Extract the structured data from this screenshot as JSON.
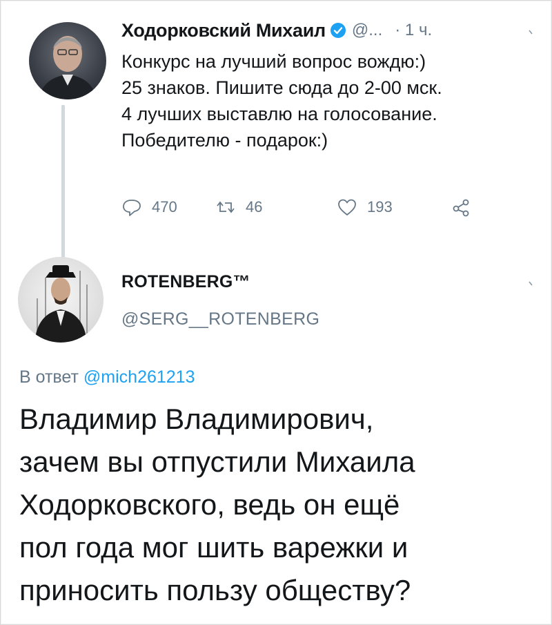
{
  "tweet1": {
    "author_name": "Ходорковский Михаил",
    "handle": "@...",
    "time": "· 1 ч.",
    "text_lines": [
      "Конкурс на лучший вопрос вождю:)",
      "25 знаков. Пишите сюда до 2-00 мск.",
      "4 лучших выставлю на голосование.",
      "Победителю - подарок:)"
    ],
    "replies": "470",
    "retweets": "46",
    "likes": "193",
    "icons": {
      "reply": "speech-bubble-icon",
      "retweet": "retweet-arrows-icon",
      "like": "heart-icon",
      "share": "share-nodes-icon",
      "verified": "verified-badge-icon"
    }
  },
  "tweet2": {
    "author_name": "ROTENBERG™",
    "handle": "@SERG__ROTENBERG",
    "reply_prefix": "В ответ",
    "reply_mention": "@mich261213",
    "text_lines": [
      "Владимир Владимирович,",
      "зачем вы отпустили Михаила",
      "Ходорковского, ведь он ещё",
      "пол года мог шить варежки и",
      "приносить пользу обществу?"
    ]
  },
  "colors": {
    "text": "#14171a",
    "muted": "#657786",
    "accent": "#1da1f2",
    "thread_line": "#cfd9de"
  }
}
